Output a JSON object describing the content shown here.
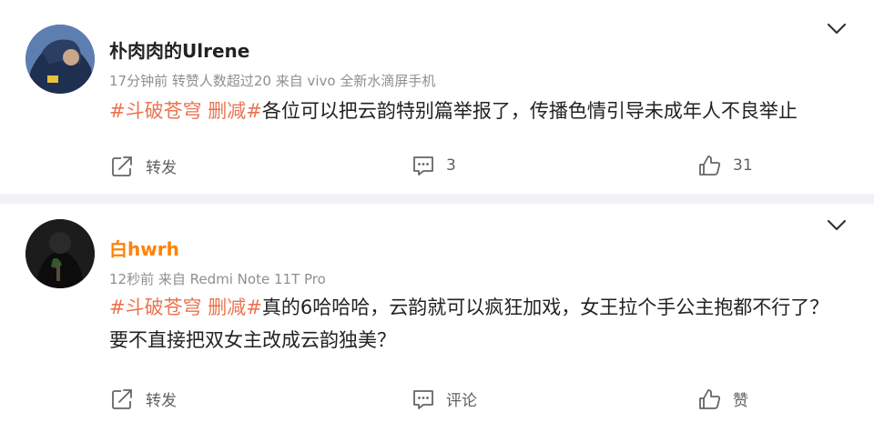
{
  "posts": [
    {
      "username": "朴肉肉的Ulrene",
      "meta": "17分钟前  转赞人数超过20  来自 vivo 全新水滴屏手机",
      "tags": [
        "#斗破苍穹 删减#"
      ],
      "text": "各位可以把云韵特别篇举报了，传播色情引导未成年人不良举止",
      "actions": {
        "repost": "转发",
        "comment": "3",
        "like": "31"
      }
    },
    {
      "username": "白hwrh",
      "meta": "12秒前  来自 Redmi Note 11T Pro",
      "tags": [
        "#斗破苍穹 删减#"
      ],
      "text_line1": "真的6哈哈哈，云韵就可以疯狂加戏，女王拉个手公主抱都不行了？",
      "text_line2": "要不直接把双女主改成云韵独美？",
      "actions": {
        "repost": "转发",
        "comment": "评论",
        "like": "赞"
      }
    }
  ],
  "colors": {
    "tag": "#eb7350",
    "vip_name": "#ff8200",
    "meta": "#8f8f8f",
    "separator": "#f1f2f5"
  },
  "icons": [
    "chevron-down-icon",
    "repost-icon",
    "comment-icon",
    "like-icon"
  ]
}
